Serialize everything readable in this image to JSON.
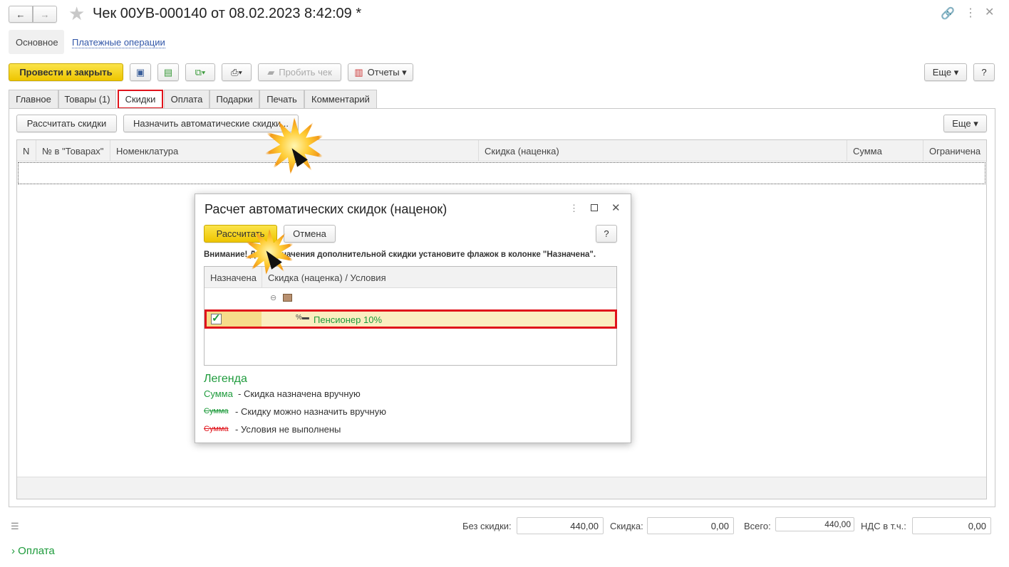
{
  "window": {
    "title": "Чек 00УВ-000140 от 08.02.2023 8:42:09 *"
  },
  "nav": {
    "main": "Основное",
    "payments": "Платежные операции"
  },
  "toolbar": {
    "post_close": "Провести и закрыть",
    "print_check": "Пробить чек",
    "reports": "Отчеты",
    "more": "Еще",
    "help": "?"
  },
  "tabs": [
    "Главное",
    "Товары (1)",
    "Скидки",
    "Оплата",
    "Подарки",
    "Печать",
    "Комментарий"
  ],
  "discounts": {
    "calc": "Рассчитать скидки",
    "assign_auto": "Назначить автоматические скидки...",
    "more": "Еще",
    "columns": [
      "N",
      "№ в \"Товарах\"",
      "Номенклатура",
      "Скидка (наценка)",
      "Сумма",
      "Ограничена"
    ]
  },
  "dialog": {
    "title": "Расчет автоматических скидок (наценок)",
    "calc": "Рассчитать",
    "cancel": "Отмена",
    "help": "?",
    "warning": "Внимание! Для назначения дополнительной скидки установите флажок в колонке \"Назначена\".",
    "columns": [
      "Назначена",
      "Скидка (наценка) / Условия"
    ],
    "row": {
      "name": "Пенсионер 10%",
      "assigned": true
    },
    "legend_title": "Легенда",
    "legend": [
      {
        "sample": "Сумма",
        "text": "- Скидка назначена вручную"
      },
      {
        "sample": "Сумма",
        "text": "- Скидку можно назначить вручную"
      },
      {
        "sample": "Сумма",
        "text": "- Условия не выполнены"
      }
    ]
  },
  "totals": {
    "no_discount_label": "Без скидки:",
    "no_discount": "440,00",
    "discount_label": "Скидка:",
    "discount": "0,00",
    "total_label": "Всего:",
    "total": "440,00",
    "vat_label": "НДС в т.ч.:",
    "vat": "0,00"
  },
  "footer": {
    "payment": "Оплата"
  },
  "colors": {
    "accent": "#f5d01e",
    "highlight": "#e0131b",
    "green": "#1e9b3c"
  }
}
